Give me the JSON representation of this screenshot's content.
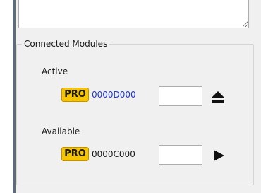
{
  "connected_modules": {
    "title": "Connected Modules",
    "active": {
      "label": "Active",
      "badge": "PRO",
      "module_id": "0000D000",
      "input_value": "",
      "action_icon": "eject-icon"
    },
    "available": {
      "label": "Available",
      "badge": "PRO",
      "module_id": "0000C000",
      "input_value": "",
      "action_icon": "play-icon"
    }
  },
  "colors": {
    "panel_bg": "#f0f0f0",
    "badge_bg": "#f7c400",
    "active_id_text": "#1f3ad6"
  }
}
